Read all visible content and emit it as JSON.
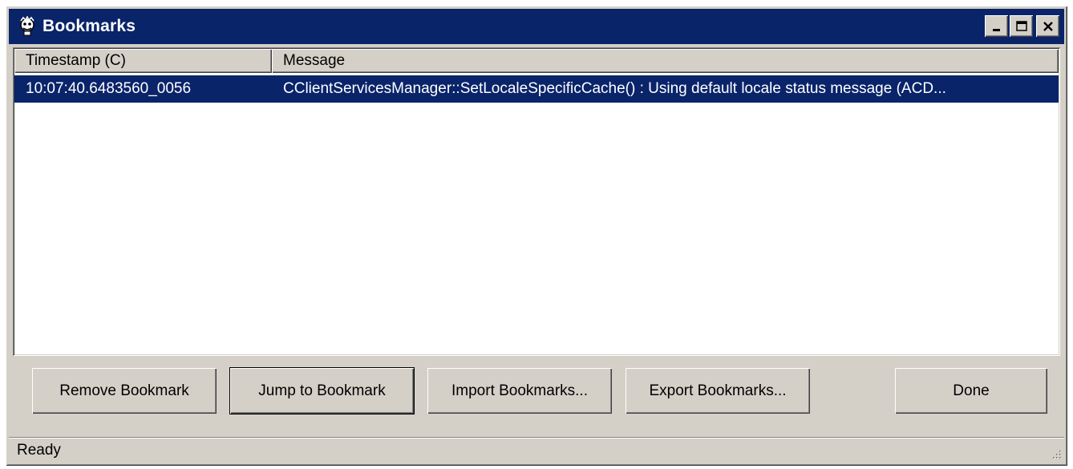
{
  "window": {
    "title": "Bookmarks",
    "controls": {
      "minimize": "minimize-icon",
      "maximize": "maximize-icon",
      "close": "close-icon"
    }
  },
  "list": {
    "columns": [
      "Timestamp (C)",
      "Message"
    ],
    "rows": [
      {
        "timestamp": "10:07:40.6483560_0056",
        "message": "CClientServicesManager::SetLocaleSpecificCache() : Using default locale status message (ACD...",
        "selected": true
      }
    ]
  },
  "buttons": {
    "remove": "Remove Bookmark",
    "jump": "Jump to Bookmark",
    "import": "Import Bookmarks...",
    "export": "Export Bookmarks...",
    "done": "Done"
  },
  "status": {
    "text": "Ready"
  },
  "colors": {
    "titlebar": "#0a246a",
    "selection": "#0a246a",
    "face": "#d4d0c8"
  }
}
